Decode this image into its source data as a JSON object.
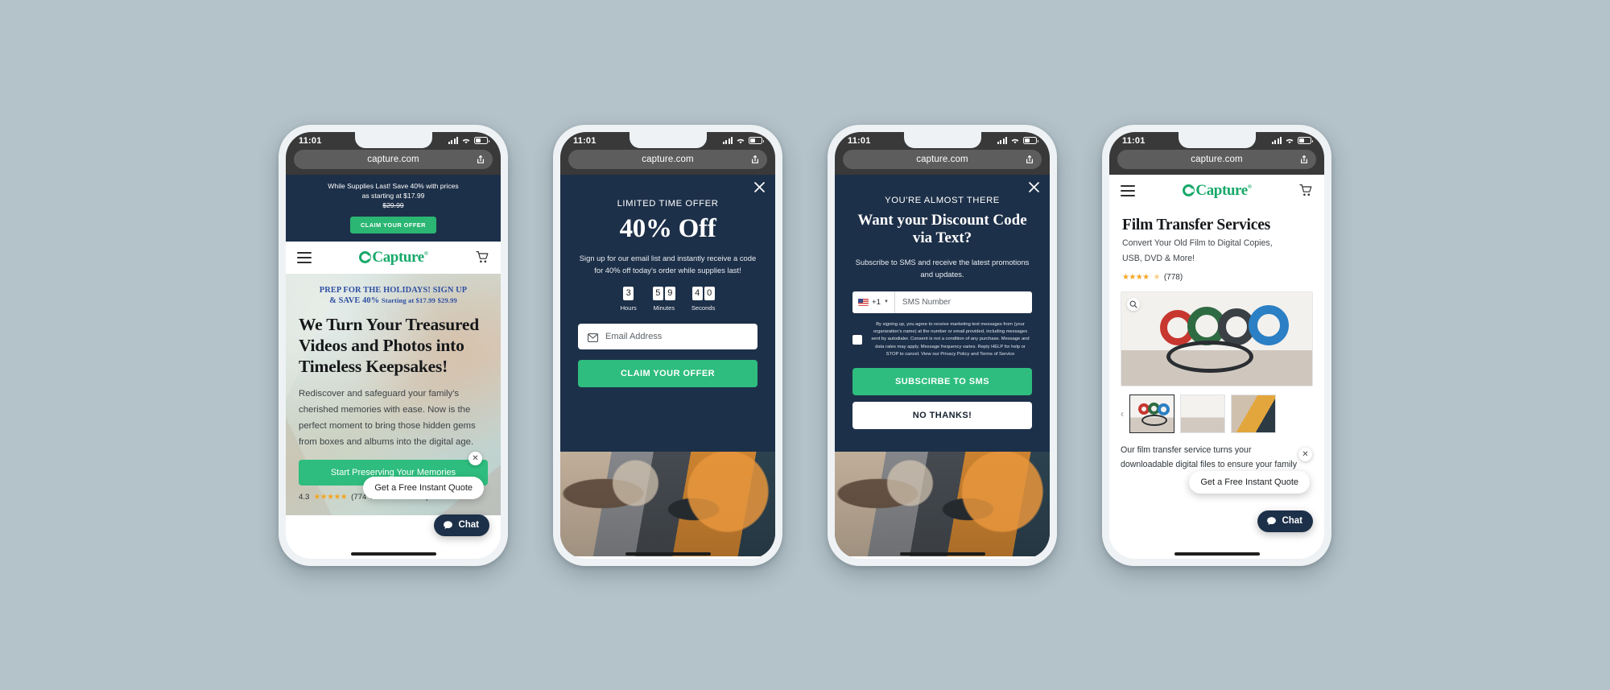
{
  "statusbar": {
    "time": "11:01"
  },
  "browser": {
    "url": "capture.com",
    "share_icon": "share-icon"
  },
  "brand": {
    "name": "Capture",
    "registered": "®",
    "green": "#18a96a",
    "navy": "#1d3049",
    "accent_green": "#2ebd7e"
  },
  "phone1": {
    "announcement": {
      "line1": "While Supplies Last! Save 40% with prices",
      "line2": "as starting at $17.99",
      "strike": "$29.99",
      "cta": "CLAIM YOUR OFFER"
    },
    "header": {
      "menu_icon": "hamburger-icon",
      "cart_icon": "shopping-cart-icon"
    },
    "hero": {
      "eyebrow_line1": "PREP FOR THE HOLIDAYS! SIGN UP",
      "eyebrow_line2": "& SAVE 40%",
      "eyebrow_small": "Starting at $17.99",
      "eyebrow_strike": "$29.99",
      "headline": "We Turn Your Treasured Videos and Photos into Timeless Keepsakes!",
      "body": "Rediscover and safeguard your family's cherished memories with ease. Now is the perfect moment to bring those hidden gems from boxes and albums into the digital age.",
      "cta": "Start Preserving Your Memories",
      "rating_value": "4.3",
      "stars": "★★★★★",
      "review_count": "(774 Verified Reviews)"
    },
    "widget": {
      "quote_pill": "Get a Free Instant Quote",
      "chat_label": "Chat",
      "close_icon": "close-icon",
      "chat_icon": "chat-bubble-icon"
    }
  },
  "phone2": {
    "close_icon": "close-icon",
    "kicker": "LIMITED TIME OFFER",
    "headline": "40% Off",
    "sub": "Sign up for our email list and instantly receive a code for 40% off today's order while supplies last!",
    "timer": [
      {
        "label": "Hours",
        "digits": [
          "3"
        ]
      },
      {
        "label": "Minutes",
        "digits": [
          "5",
          "9"
        ]
      },
      {
        "label": "Seconds",
        "digits": [
          "4",
          "0"
        ]
      }
    ],
    "email_placeholder": "Email Address",
    "email_icon": "envelope-icon",
    "cta": "CLAIM YOUR OFFER"
  },
  "phone3": {
    "close_icon": "close-icon",
    "kicker": "YOU'RE ALMOST THERE",
    "headline_line1": "Want your Discount Code",
    "headline_line2": "via Text?",
    "sub": "Subscribe to SMS and receive the latest promotions and updates.",
    "country_code": "+1",
    "flag_icon": "us-flag-icon",
    "caret_icon": "chevron-down-icon",
    "sms_placeholder": "SMS Number",
    "consent": "By signing up, you agree to receive marketing text messages from (your organization's name) at the number or email provided, including messages sent by autodialer. Consent is not a condition of any purchase. Message and data rates may apply. Message frequency varies. Reply HELP for help or STOP to cancel. View our Privacy Policy and Terms of Service",
    "cta_primary": "SUBSCIRBE TO SMS",
    "cta_secondary": "NO THANKS!"
  },
  "phone4": {
    "header": {
      "menu_icon": "hamburger-icon",
      "cart_icon": "shopping-cart-icon"
    },
    "title": "Film Transfer Services",
    "tagline_line1": "Convert Your Old Film to Digital Copies,",
    "tagline_line2": "USB, DVD & More!",
    "stars": "★★★★",
    "half_star": "★",
    "review_count": "(778)",
    "zoom_icon": "magnifier-icon",
    "prev_arrow": "chevron-left-icon",
    "copy_line1": "Our film transfer service turns your",
    "copy_line2": "downloadable digital files to ensure your family",
    "widget": {
      "quote_pill": "Get a Free Instant Quote",
      "chat_label": "Chat",
      "close_icon": "close-icon",
      "chat_icon": "chat-bubble-icon"
    }
  }
}
